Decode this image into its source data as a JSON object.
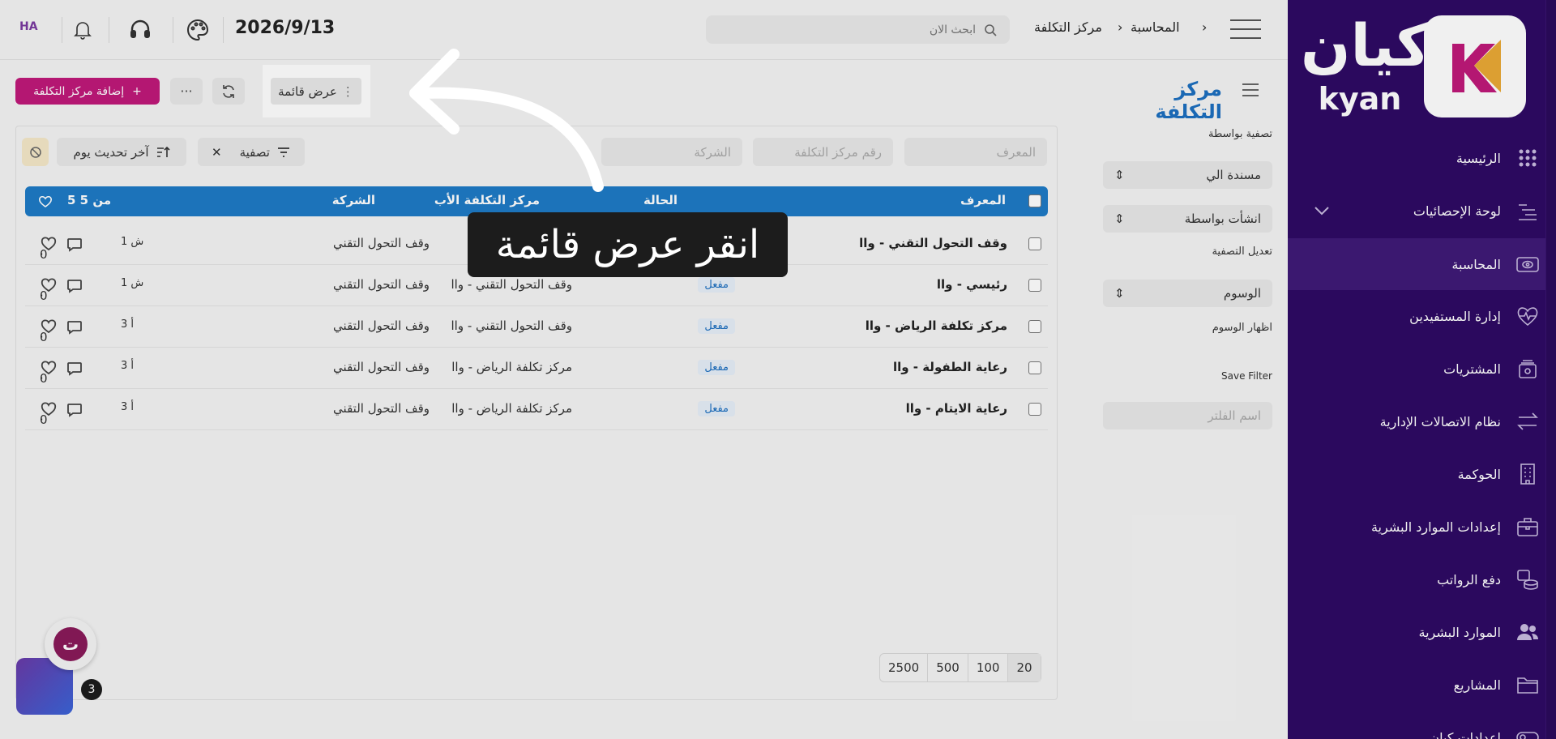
{
  "brand": {
    "name_ar": "كيان",
    "name_en": "kyan",
    "logo_colors": [
      "#c0197a",
      "#e8a020"
    ]
  },
  "sidebar": {
    "items": [
      {
        "label": "الرئيسية",
        "icon": "grid-dots-icon"
      },
      {
        "label": "لوحة الإحصائيات",
        "icon": "bars-list-icon"
      },
      {
        "label": "المحاسبة",
        "icon": "money-eye-icon"
      },
      {
        "label": "إدارة المستفيدين",
        "icon": "heart-pulse-icon"
      },
      {
        "label": "المشتريات",
        "icon": "cart-box-icon"
      },
      {
        "label": "نظام الاتصالات الإدارية",
        "icon": "arrows-exchange-icon"
      },
      {
        "label": "الحوكمة",
        "icon": "building-icon"
      },
      {
        "label": "إعدادات الموارد البشرية",
        "icon": "briefcase-icon"
      },
      {
        "label": "دفع الرواتب",
        "icon": "coins-icon"
      },
      {
        "label": "الموارد البشرية",
        "icon": "users-icon"
      },
      {
        "label": "المشاريع",
        "icon": "folder-icon"
      },
      {
        "label": "إعدادات كيان",
        "icon": "toggle-icon"
      }
    ]
  },
  "topbar": {
    "breadcrumb": [
      "المحاسبة",
      "مركز التكلفة"
    ],
    "search_placeholder": "ابحث الان",
    "date": "2026/9/13",
    "avatar": "HA"
  },
  "page": {
    "title": "مركز التكلفة",
    "add_button": "إضافة مركز التكلفة",
    "add_plus": "+",
    "more": "···",
    "view_button": "عرض قائمة"
  },
  "filters": {
    "filter_by": "تصفية بواسطة",
    "assigned_to": "مسندة الي",
    "created_by": "انشأت بواسطة",
    "edit_filter": "تعديل التصفية",
    "tags": "الوسوم",
    "show_tags": "اظهار الوسوم",
    "save_filter": "Save Filter",
    "filter_name_placeholder": "اسم الفلتر"
  },
  "list": {
    "field_id": "المعرف",
    "field_number": "رقم مركز التكلفة",
    "field_company": "الشركة",
    "filter_chip": "تصفية",
    "sort_chip": "آخر تحديث يوم",
    "columns": {
      "id": "المعرف",
      "status": "الحالة",
      "parent": "مركز التكلفة الأب",
      "company": "الشركة",
      "count": "5 من 5"
    },
    "rows": [
      {
        "name": "وقف التحول التقني - واا",
        "status": "",
        "parent": "",
        "company": "وقف التحول التقني",
        "comments": "0",
        "age": "1 ش"
      },
      {
        "name": "رئيسي - واا",
        "status": "مفعل",
        "parent": "وقف التحول التقني - واا",
        "company": "وقف التحول التقني",
        "comments": "0",
        "age": "1 ش"
      },
      {
        "name": "مركز تكلفة الرياض - واا",
        "status": "مفعل",
        "parent": "وقف التحول التقني - واا",
        "company": "وقف التحول التقني",
        "comments": "0",
        "age": "3 أ"
      },
      {
        "name": "رعاية الطفولة - واا",
        "status": "مفعل",
        "parent": "مركز تكلفة الرياض - واا",
        "company": "وقف التحول التقني",
        "comments": "0",
        "age": "3 أ"
      },
      {
        "name": "رعاية الايتام - واا",
        "status": "مفعل",
        "parent": "مركز تكلفة الرياض - واا",
        "company": "وقف التحول التقني",
        "comments": "0",
        "age": "3 أ"
      }
    ],
    "page_sizes": [
      "20",
      "100",
      "500",
      "2500"
    ],
    "dot": "·"
  },
  "tutorial": {
    "text": "انقر عرض قائمة"
  },
  "chat": {
    "count": "3"
  },
  "colors": {
    "sidebar": "#2e0a64",
    "accent": "#1c6fc0",
    "add": "#c0197a"
  }
}
